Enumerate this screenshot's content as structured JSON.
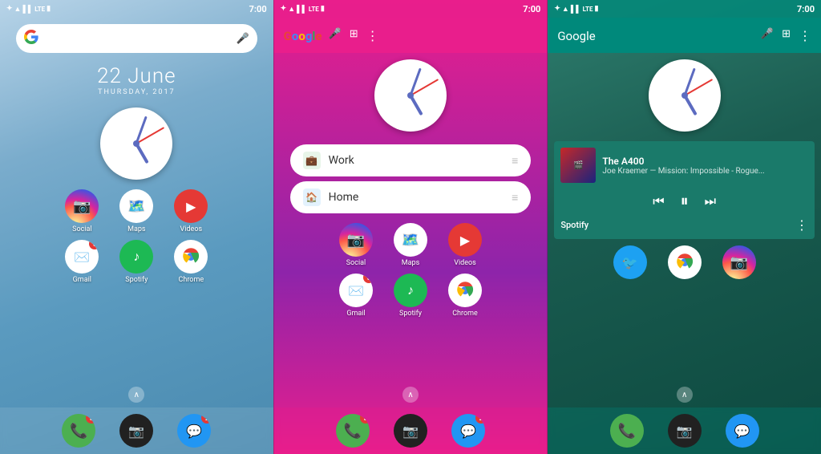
{
  "panels": [
    {
      "id": "panel-1",
      "theme": "ice",
      "status": {
        "left_icons": [
          "bluetooth",
          "wifi",
          "signal",
          "lte",
          "battery"
        ],
        "time": "7:00"
      },
      "date": {
        "display": "22 June",
        "sub": "THURSDAY, 2017"
      },
      "clock": true,
      "folders": [],
      "app_rows": [
        [
          {
            "name": "Social",
            "type": "instagram",
            "badge": null
          },
          {
            "name": "Maps",
            "type": "maps",
            "badge": null
          },
          {
            "name": "Videos",
            "type": "videos",
            "badge": null
          }
        ],
        [
          {
            "name": "Gmail",
            "type": "gmail",
            "badge": "5"
          },
          {
            "name": "Spotify",
            "type": "spotify",
            "badge": null
          },
          {
            "name": "Chrome",
            "type": "chrome",
            "badge": null
          }
        ]
      ],
      "dock": [
        {
          "name": "Phone",
          "type": "phone",
          "badge": "3"
        },
        {
          "name": "Camera",
          "type": "camera",
          "badge": null
        },
        {
          "name": "Messages",
          "type": "messages",
          "badge": "2"
        }
      ]
    },
    {
      "id": "panel-2",
      "theme": "pink",
      "status": {
        "left_icons": [
          "bluetooth",
          "wifi",
          "signal",
          "lte",
          "battery"
        ],
        "time": "7:00"
      },
      "appbar": {
        "logo": "Google",
        "logo_colors": [
          "#ea4335",
          "#4285f4",
          "#fbbc05",
          "#4285f4",
          "#34a853",
          "#ea4335"
        ]
      },
      "clock": true,
      "folders": [
        {
          "name": "Work",
          "icon": "💼",
          "icon_bg": "#4caf50"
        },
        {
          "name": "Home",
          "icon": "🏠",
          "icon_bg": "#2196f3"
        }
      ],
      "app_rows": [
        [
          {
            "name": "Social",
            "type": "instagram",
            "badge": null
          },
          {
            "name": "Maps",
            "type": "maps",
            "badge": null
          },
          {
            "name": "Videos",
            "type": "videos",
            "badge": null
          }
        ],
        [
          {
            "name": "Gmail",
            "type": "gmail",
            "badge": "5"
          },
          {
            "name": "Spotify",
            "type": "spotify",
            "badge": null
          },
          {
            "name": "Chrome",
            "type": "chrome",
            "badge": null
          }
        ]
      ],
      "dock": [
        {
          "name": "Phone",
          "type": "phone",
          "badge": "3"
        },
        {
          "name": "Camera",
          "type": "camera",
          "badge": null
        },
        {
          "name": "Messages",
          "type": "messages",
          "badge": "2"
        }
      ]
    },
    {
      "id": "panel-3",
      "theme": "teal",
      "status": {
        "left_icons": [
          "bluetooth",
          "wifi",
          "signal",
          "lte",
          "battery"
        ],
        "time": "7:00"
      },
      "appbar": {
        "text": "Google"
      },
      "clock": true,
      "music": {
        "title": "The A400",
        "artist": "Joe Kraemer — Mission: Impossible - Rogue...",
        "player": "Spotify"
      },
      "app_rows": [
        [
          {
            "name": "Twitter",
            "type": "twitter",
            "badge": null
          },
          {
            "name": "Chrome",
            "type": "chrome",
            "badge": null
          },
          {
            "name": "Instagram",
            "type": "instagram",
            "badge": null
          }
        ]
      ],
      "dock": [
        {
          "name": "Phone",
          "type": "phone",
          "badge": null
        },
        {
          "name": "Camera",
          "type": "camera",
          "badge": null
        },
        {
          "name": "Messages",
          "type": "messages",
          "badge": null
        }
      ]
    }
  ]
}
